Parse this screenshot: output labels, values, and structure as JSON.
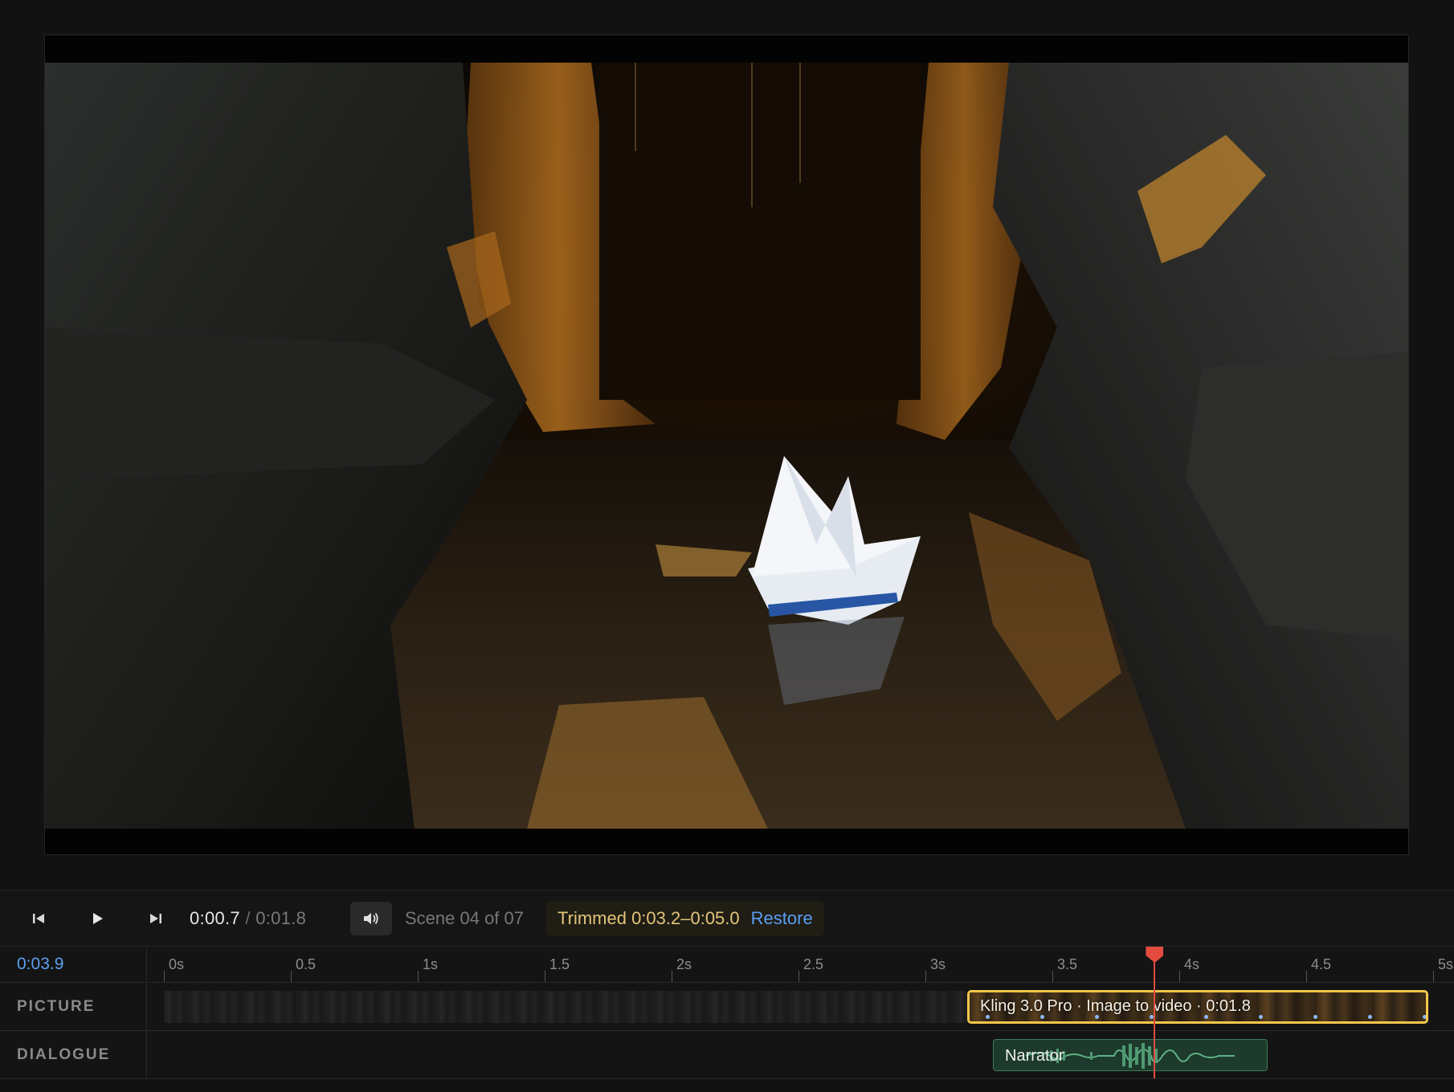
{
  "transport": {
    "current_time": "0:00.7",
    "separator": " / ",
    "total_time": "0:01.8",
    "scene_label": "Scene 04 of 07",
    "trim_text": "Trimmed 0:03.2–0:05.0",
    "restore_label": "Restore"
  },
  "timeline": {
    "playhead_time": "0:03.9",
    "playhead_seconds": 3.9,
    "duration_seconds": 5,
    "ruler_labels": [
      "0s",
      "0.5",
      "1s",
      "1.5",
      "2s",
      "2.5",
      "3s",
      "3.5",
      "4s",
      "4.5",
      "5s"
    ],
    "tracks": {
      "picture": "PICTURE",
      "dialogue": "DIALOGUE"
    },
    "picture_clip": {
      "label": "Kling 3.0 Pro · Image to video · 0:01.8",
      "start_seconds": 3.2,
      "end_seconds": 5.0
    },
    "dialogue_clip": {
      "label": "Narrator"
    }
  },
  "colors": {
    "accent_blue": "#5b9ff0",
    "clip_border": "#f3c64b",
    "playhead": "#e24b3d",
    "dialogue_clip": "#1d3a2c"
  },
  "icons": {
    "prev": "skip-back-icon",
    "play": "play-icon",
    "next": "skip-forward-icon",
    "volume": "volume-icon"
  }
}
